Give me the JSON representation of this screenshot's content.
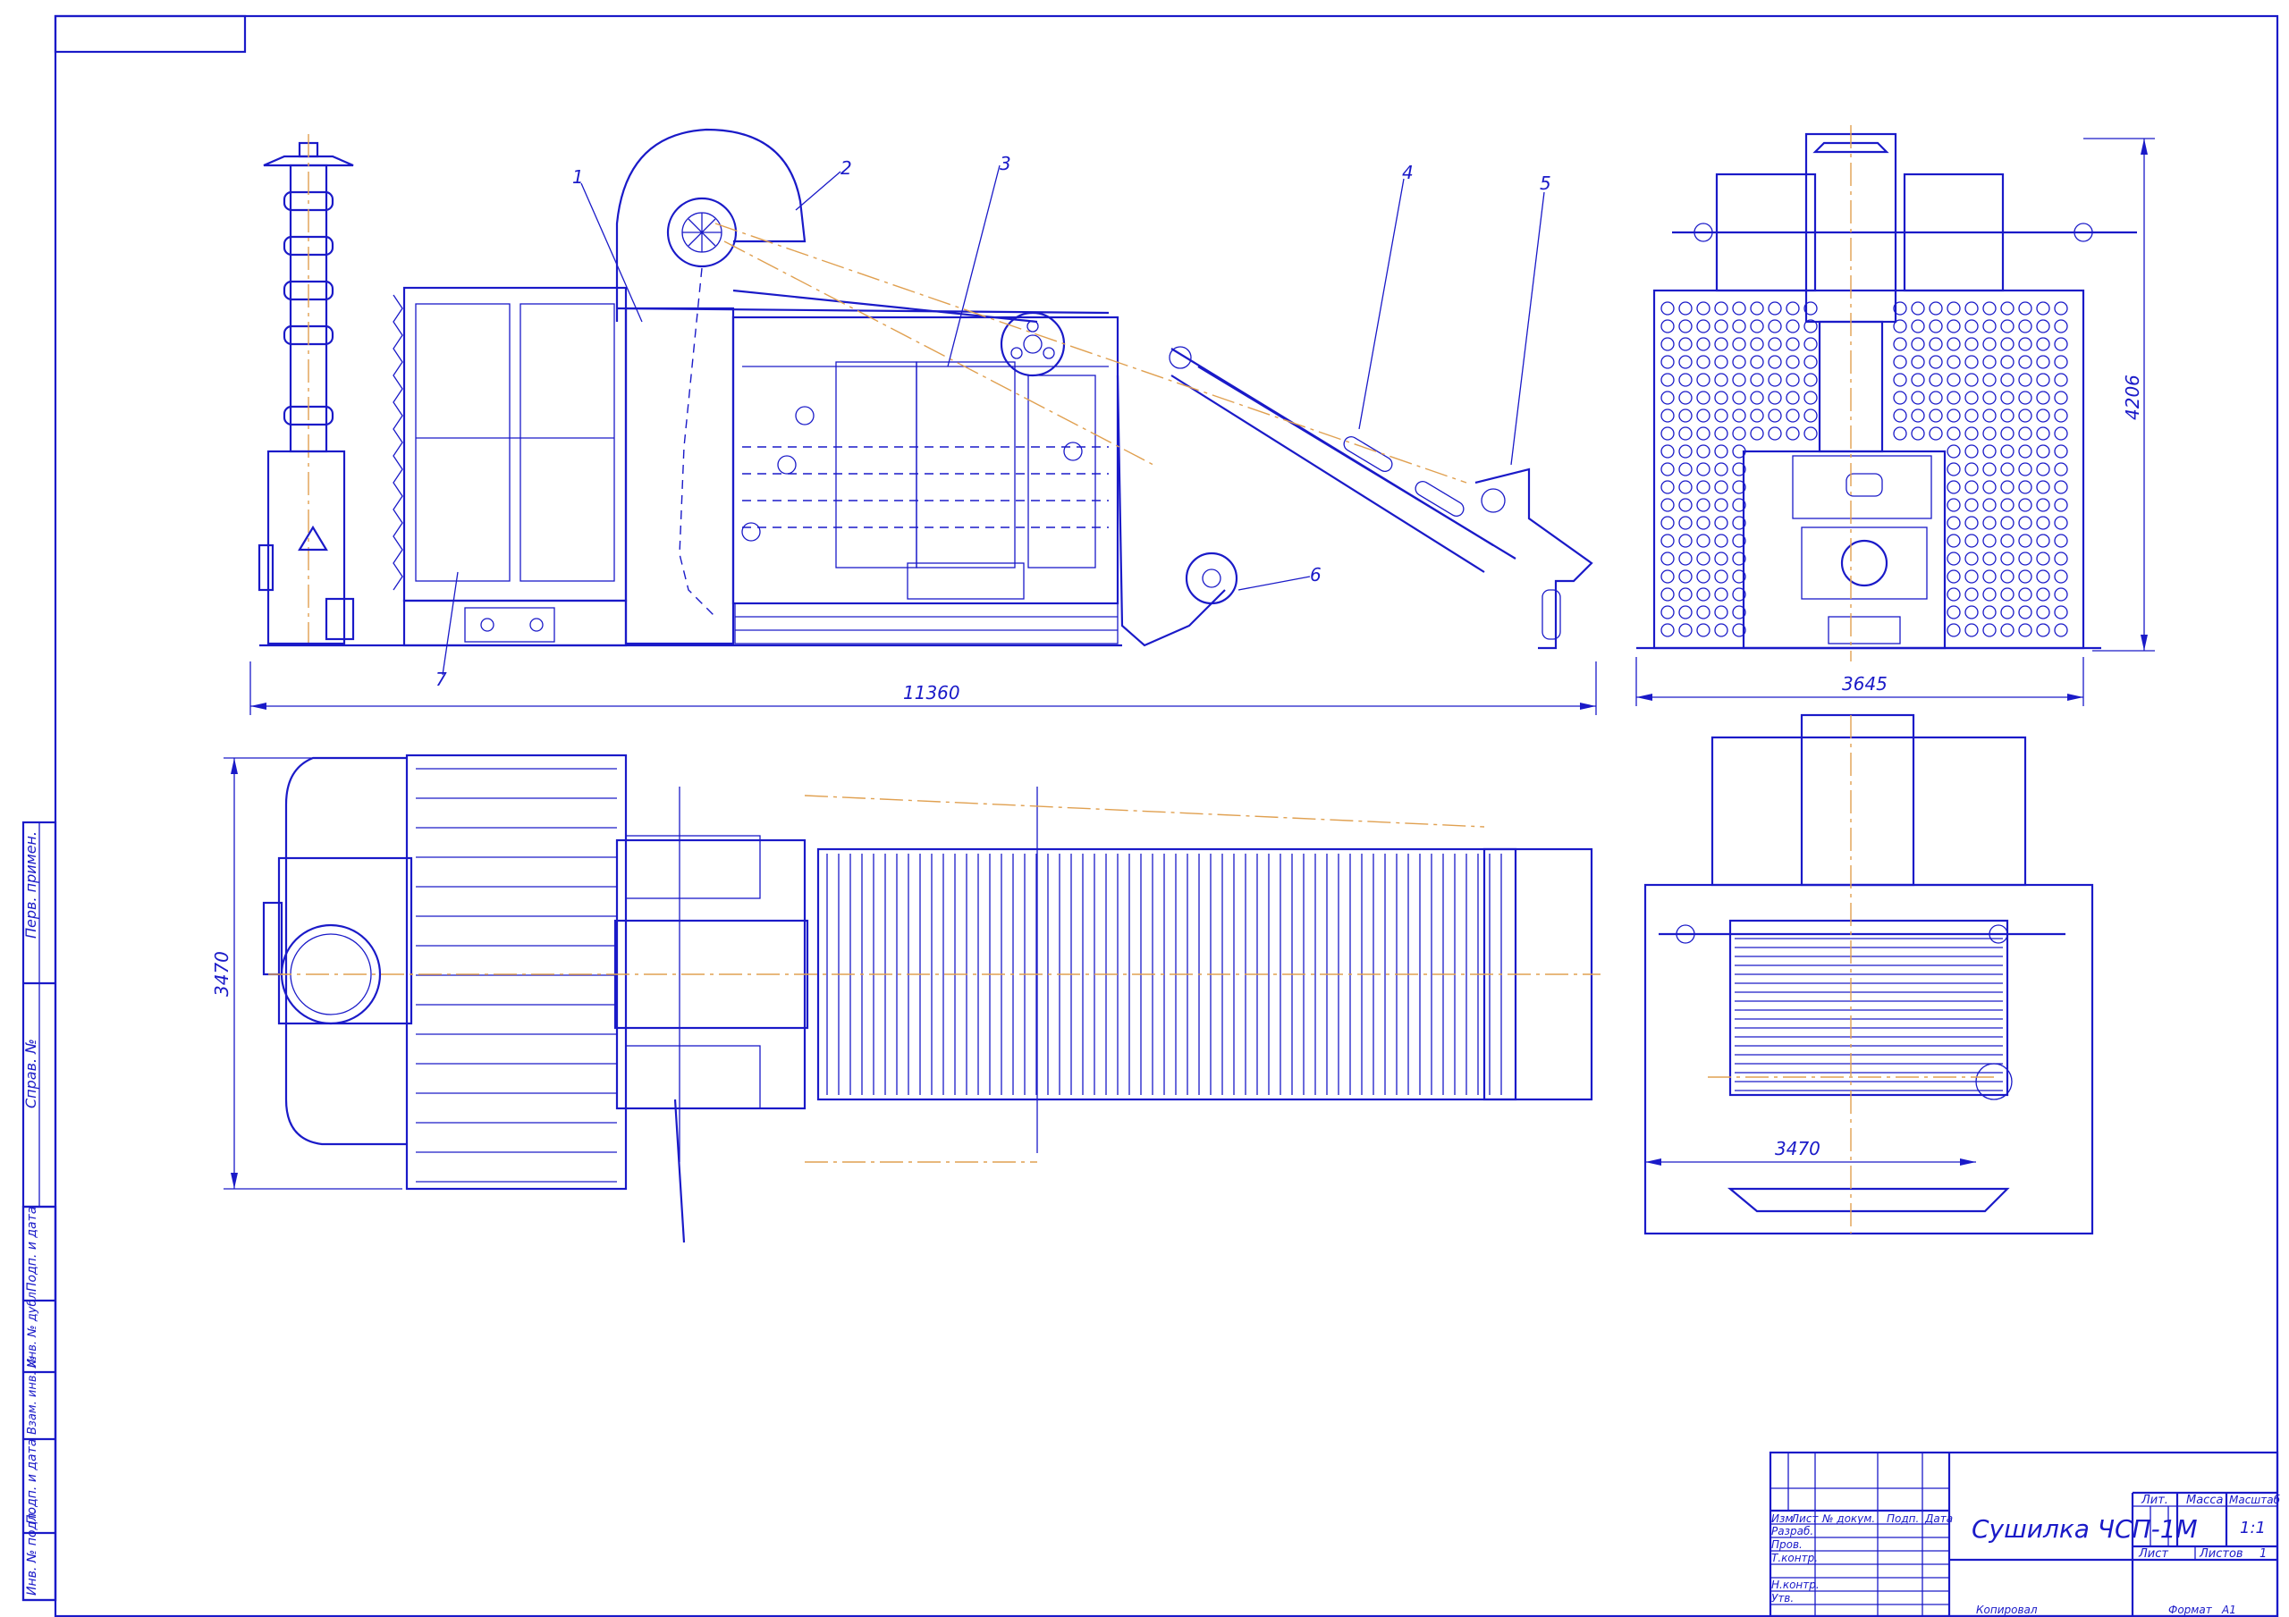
{
  "drawing": {
    "dimensions": {
      "length_side": "11360",
      "height_front": "4206",
      "width_front": "3645",
      "width_plan": "3470",
      "width_end": "3470"
    },
    "leaders": [
      "1",
      "2",
      "3",
      "4",
      "5",
      "6",
      "7"
    ]
  },
  "title_block": {
    "name": "Сушилка ЧСП-1М",
    "columns": [
      "Изм",
      "Лист",
      "№ докум.",
      "Подп.",
      "Дата"
    ],
    "rows": [
      "Разраб.",
      "Пров.",
      "Т.контр.",
      "",
      "Н.контр.",
      "Утв."
    ],
    "lit_label": "Лит.",
    "mass_label": "Масса",
    "scale_label": "Масштаб",
    "scale_value": "1:1",
    "sheet_label": "Лист",
    "sheets_label": "Листов",
    "sheets_value": "1",
    "copied": "Копировал",
    "format_label": "Формат",
    "format_value": "A1"
  },
  "side_stamp": [
    "Перв. примен.",
    "Справ. №",
    "Подп. и дата",
    "Инв. № дубл.",
    "Взам. инв. №",
    "Подп. и дата",
    "Инв. № подл."
  ],
  "colors": {
    "line": "#1a1ac8",
    "axis": "#e0a050",
    "paper": "#ffffff"
  }
}
